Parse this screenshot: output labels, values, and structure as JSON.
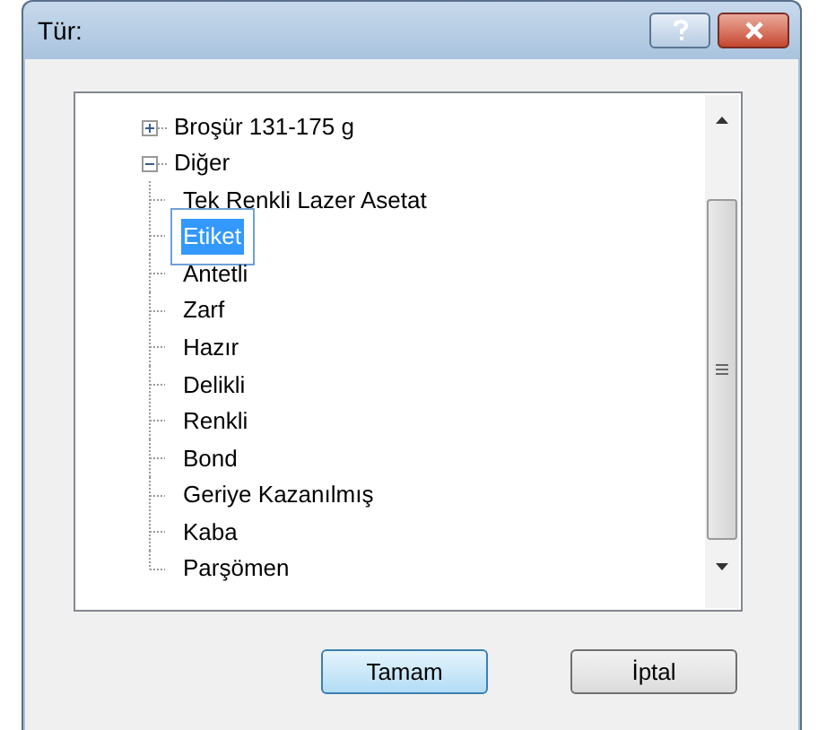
{
  "window": {
    "title": "Tür:"
  },
  "tree": [
    {
      "label": "Broşür 131-175 g",
      "expanded": false,
      "selected": false
    },
    {
      "label": "Diğer",
      "expanded": true,
      "selected": false,
      "children": [
        {
          "label": "Tek Renkli Lazer Asetat",
          "selected": false
        },
        {
          "label": "Etiket",
          "selected": true
        },
        {
          "label": "Antetli",
          "selected": false
        },
        {
          "label": "Zarf",
          "selected": false
        },
        {
          "label": "Hazır",
          "selected": false
        },
        {
          "label": "Delikli",
          "selected": false
        },
        {
          "label": "Renkli",
          "selected": false
        },
        {
          "label": "Bond",
          "selected": false
        },
        {
          "label": "Geriye Kazanılmış",
          "selected": false
        },
        {
          "label": "Kaba",
          "selected": false
        },
        {
          "label": "Parşömen",
          "selected": false
        }
      ]
    }
  ],
  "buttons": [
    {
      "label": "Tamam",
      "default": true
    },
    {
      "label": "İptal",
      "default": false
    }
  ]
}
